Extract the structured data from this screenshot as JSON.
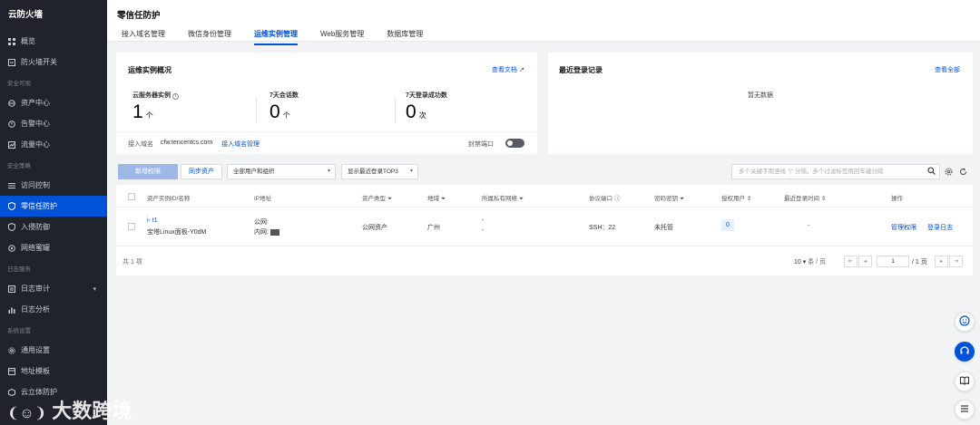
{
  "sidebar": {
    "brand": "云防火墙",
    "items": [
      {
        "label": "概览"
      },
      {
        "label": "防火墙开关"
      },
      {
        "group": "安全可视"
      },
      {
        "label": "资产中心"
      },
      {
        "label": "告警中心"
      },
      {
        "label": "流量中心"
      },
      {
        "group": "安全策略"
      },
      {
        "label": "访问控制"
      },
      {
        "label": "零信任防护"
      },
      {
        "label": "入侵防御"
      },
      {
        "label": "网络蜜罐"
      },
      {
        "group": "日志服务"
      },
      {
        "label": "日志审计"
      },
      {
        "label": "日志分析"
      },
      {
        "group": "系统设置"
      },
      {
        "label": "通用设置"
      },
      {
        "label": "地址模板"
      },
      {
        "label": "云立体防护"
      }
    ]
  },
  "header": {
    "title": "零信任防护",
    "tabs": [
      "接入域名管理",
      "微信身份管理",
      "运维实例管理",
      "Web服务管理",
      "数据库管理"
    ]
  },
  "overview": {
    "title": "运维实例概况",
    "docs_link": "查看文档",
    "stats": [
      {
        "label": "云服务器实例",
        "value": "1",
        "unit": "个"
      },
      {
        "label": "7天会话数",
        "value": "0",
        "unit": "个"
      },
      {
        "label": "7天登录成功数",
        "value": "0",
        "unit": "次"
      }
    ],
    "domain_label": "接入域名",
    "domain_value": "cfw.tencentcs.com",
    "domain_manage_link": "接入域名管理",
    "port_label": "封禁端口"
  },
  "login_records": {
    "title": "最近登录记录",
    "view_all": "查看全部",
    "empty": "暂无数据"
  },
  "toolbar": {
    "add_button": "新增权限",
    "sync_button": "同步资产",
    "user_select": "全部用户和组织",
    "top_select": "显示最近登录TOP3",
    "search_placeholder": "多个关键字用竖线 \"|\" 分隔，多个过滤标签用回车键分隔"
  },
  "table": {
    "columns": [
      "资产实例ID/名称",
      "IP地址",
      "资产类型",
      "地域",
      "所属私有网络",
      "协议端口",
      "密码密钥",
      "授权用户",
      "最近登录时间",
      "操作"
    ],
    "rows": [
      {
        "id": "i-            t1",
        "name": "宝塔Linux面板-Y0dM",
        "ip_public": "公网:",
        "ip_private": "内网:",
        "type": "公网资产",
        "region": "广州",
        "vpc1": "-",
        "vpc2": "-",
        "port": "SSH：22",
        "secret": "未托管",
        "auth_users": "0",
        "last_login": "-",
        "actions": [
          "管理权限",
          "登录日志"
        ]
      }
    ],
    "total": "共 1 项",
    "page_size": "10",
    "page_size_unit": "条 / 页",
    "current_page": "1",
    "page_total": "/ 1 页"
  },
  "watermark": "大数跨境"
}
